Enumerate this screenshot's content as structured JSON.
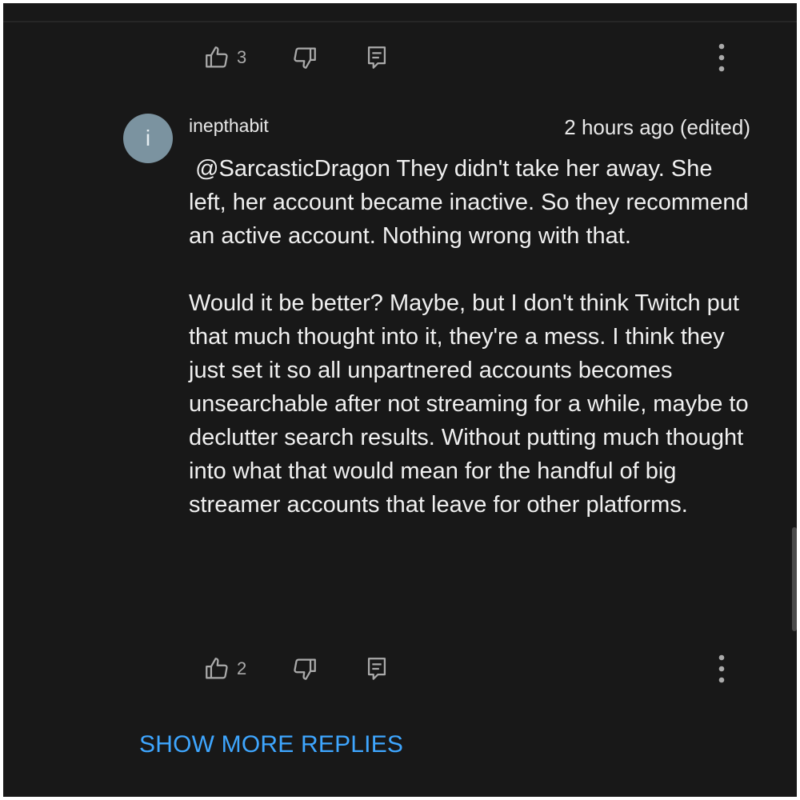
{
  "colors": {
    "background": "#181818",
    "text": "#f0f0f0",
    "muted": "#aaaaaa",
    "link": "#3ea6ff",
    "avatar": "#7b93a0"
  },
  "previous_comment_actions": {
    "like_count": "3",
    "icons": [
      "thumbs-up-icon",
      "thumbs-down-icon",
      "reply-icon",
      "more-vertical-icon"
    ]
  },
  "comment": {
    "avatar_letter": "i",
    "author": "inepthabit",
    "timestamp": "2 hours ago (edited)",
    "mention": "@SarcasticDragon",
    "paragraph_1_text": " They didn't take her away. She left, her account became inactive. So they recommend an active account. Nothing wrong with that.",
    "paragraph_2_text": "Would it be better? Maybe, but I don't think Twitch put that much thought into it, they're a mess. I think they just set it so all unpartnered accounts becomes unsearchable after not streaming for a while, maybe to declutter search results. Without putting much thought into what that would mean for the handful of big streamer accounts that leave for other platforms.",
    "like_count": "2"
  },
  "show_more_replies_label": "SHOW MORE REPLIES"
}
